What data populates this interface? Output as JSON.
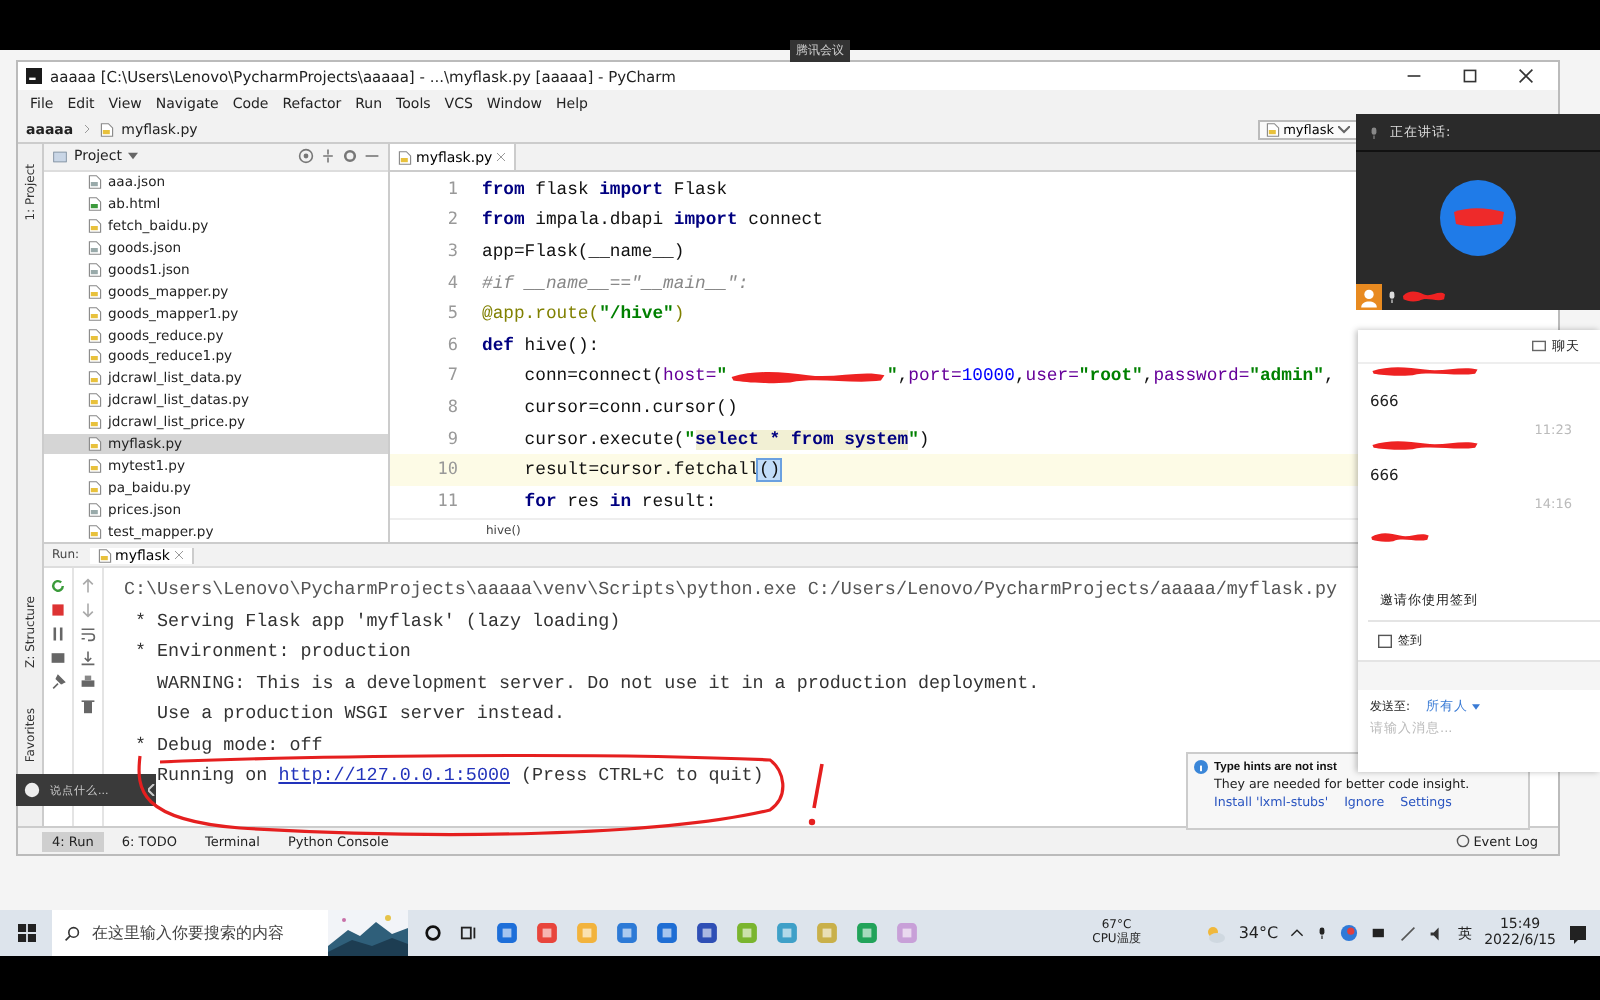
{
  "meeting_tag": "腾讯会议",
  "window": {
    "title": "aaaaa [C:\\Users\\Lenovo\\PycharmProjects\\aaaaa] - ...\\myflask.py [aaaaa] - PyCharm"
  },
  "menu": [
    "File",
    "Edit",
    "View",
    "Navigate",
    "Code",
    "Refactor",
    "Run",
    "Tools",
    "VCS",
    "Window",
    "Help"
  ],
  "breadcrumb": [
    "aaaaa",
    "myflask.py"
  ],
  "run_config": "myflask",
  "side_tabs": {
    "top": [
      "1: Project"
    ],
    "bottom": [
      "Z: Structure",
      "Favorites"
    ]
  },
  "project": {
    "title": "Project",
    "files": [
      {
        "name": "aaa.json",
        "kind": "json",
        "selected": false
      },
      {
        "name": "ab.html",
        "kind": "html",
        "selected": false
      },
      {
        "name": "fetch_baidu.py",
        "kind": "py",
        "selected": false
      },
      {
        "name": "goods.json",
        "kind": "json",
        "selected": false
      },
      {
        "name": "goods1.json",
        "kind": "json",
        "selected": false
      },
      {
        "name": "goods_mapper.py",
        "kind": "py",
        "selected": false
      },
      {
        "name": "goods_mapper1.py",
        "kind": "py",
        "selected": false
      },
      {
        "name": "goods_reduce.py",
        "kind": "py",
        "selected": false
      },
      {
        "name": "goods_reduce1.py",
        "kind": "py",
        "selected": false
      },
      {
        "name": "jdcrawl_list_data.py",
        "kind": "py",
        "selected": false
      },
      {
        "name": "jdcrawl_list_datas.py",
        "kind": "py",
        "selected": false
      },
      {
        "name": "jdcrawl_list_price.py",
        "kind": "py",
        "selected": false
      },
      {
        "name": "myflask.py",
        "kind": "py",
        "selected": true
      },
      {
        "name": "mytest1.py",
        "kind": "py",
        "selected": false
      },
      {
        "name": "pa_baidu.py",
        "kind": "py",
        "selected": false
      },
      {
        "name": "prices.json",
        "kind": "json",
        "selected": false
      },
      {
        "name": "test_mapper.py",
        "kind": "py",
        "selected": false
      }
    ]
  },
  "editor": {
    "tab": "myflask.py",
    "breadcrumb": "hive()",
    "lines": [
      {
        "number": "1",
        "current": false,
        "tokens": [
          {
            "kind": "keyword",
            "text": "from"
          },
          {
            "kind": "plain",
            "text": " flask "
          },
          {
            "kind": "keyword",
            "text": "import"
          },
          {
            "kind": "plain",
            "text": " Flask"
          }
        ]
      },
      {
        "number": "2",
        "current": false,
        "tokens": [
          {
            "kind": "keyword",
            "text": "from"
          },
          {
            "kind": "plain",
            "text": " impala.dbapi "
          },
          {
            "kind": "keyword",
            "text": "import"
          },
          {
            "kind": "plain",
            "text": " connect"
          }
        ]
      },
      {
        "number": "3",
        "current": false,
        "tokens": [
          {
            "kind": "plain",
            "text": "app=Flask(__name__)"
          }
        ]
      },
      {
        "number": "4",
        "current": false,
        "tokens": [
          {
            "kind": "comment",
            "text": "#if __name__==\"__main__\":"
          }
        ]
      },
      {
        "number": "5",
        "current": false,
        "tokens": [
          {
            "kind": "decorator",
            "text": "@app.route("
          },
          {
            "kind": "string",
            "text": "\"/hive\""
          },
          {
            "kind": "decorator",
            "text": ")"
          }
        ]
      },
      {
        "number": "6",
        "current": false,
        "tokens": [
          {
            "kind": "keyword",
            "text": "def"
          },
          {
            "kind": "plain",
            "text": " hive():"
          }
        ]
      },
      {
        "number": "7",
        "current": false,
        "tokens": [
          {
            "kind": "plain",
            "text": "    conn=connect("
          },
          {
            "kind": "param",
            "text": "host="
          },
          {
            "kind": "string",
            "text": "\""
          },
          {
            "kind": "redacted"
          },
          {
            "kind": "string",
            "text": "\""
          },
          {
            "kind": "plain",
            "text": ","
          },
          {
            "kind": "param",
            "text": "port="
          },
          {
            "kind": "number",
            "text": "10000"
          },
          {
            "kind": "plain",
            "text": ","
          },
          {
            "kind": "param",
            "text": "user="
          },
          {
            "kind": "string",
            "text": "\"root\""
          },
          {
            "kind": "plain",
            "text": ","
          },
          {
            "kind": "param",
            "text": "password="
          },
          {
            "kind": "string",
            "text": "\"admin\""
          },
          {
            "kind": "plain",
            "text": ","
          }
        ]
      },
      {
        "number": "8",
        "current": false,
        "tokens": [
          {
            "kind": "plain",
            "text": "    cursor=conn.cursor()"
          }
        ]
      },
      {
        "number": "9",
        "current": false,
        "tokens": [
          {
            "kind": "plain",
            "text": "    cursor.execute("
          },
          {
            "kind": "string",
            "text": "\""
          },
          {
            "kind": "sql",
            "text": "select * from system"
          },
          {
            "kind": "string",
            "text": "\""
          },
          {
            "kind": "plain",
            "text": ")"
          }
        ]
      },
      {
        "number": "10",
        "current": true,
        "tokens": [
          {
            "kind": "plain",
            "text": "    result=cursor.fetchall"
          },
          {
            "kind": "match",
            "text": "()"
          }
        ]
      },
      {
        "number": "11",
        "current": false,
        "tokens": [
          {
            "kind": "keyword",
            "text": "    for"
          },
          {
            "kind": "plain",
            "text": " res "
          },
          {
            "kind": "keyword",
            "text": "in"
          },
          {
            "kind": "plain",
            "text": " result:"
          }
        ]
      }
    ]
  },
  "run": {
    "label": "Run:",
    "tab": "myflask",
    "lines": [
      {
        "kind": "command",
        "segments": [
          {
            "kind": "text",
            "text": "C:\\Users\\Lenovo\\PycharmProjects\\aaaaa\\venv\\Scripts\\python.exe C:/Users/Lenovo/PycharmProjects/aaaaa/myflask.py"
          }
        ]
      },
      {
        "kind": "output",
        "segments": [
          {
            "kind": "text",
            "text": " * Serving Flask app 'myflask' (lazy loading)"
          }
        ]
      },
      {
        "kind": "output",
        "segments": [
          {
            "kind": "text",
            "text": " * Environment: production"
          }
        ]
      },
      {
        "kind": "output",
        "segments": [
          {
            "kind": "text",
            "text": "   WARNING: This is a development server. Do not use it in a production deployment."
          }
        ]
      },
      {
        "kind": "output",
        "segments": [
          {
            "kind": "text",
            "text": "   Use a production WSGI server instead."
          }
        ]
      },
      {
        "kind": "output",
        "segments": [
          {
            "kind": "text",
            "text": " * Debug mode: off"
          }
        ]
      },
      {
        "kind": "output",
        "segments": [
          {
            "kind": "text",
            "text": "   Running on "
          },
          {
            "kind": "link",
            "text": "http://127.0.0.1:5000"
          },
          {
            "kind": "text",
            "text": " (Press CTRL+C to quit)"
          }
        ]
      }
    ]
  },
  "tool_tabs": [
    {
      "label": "4: Run",
      "selected": true
    },
    {
      "label": "6: TODO",
      "selected": false
    },
    {
      "label": "Terminal",
      "selected": false
    },
    {
      "label": "Python Console",
      "selected": false
    }
  ],
  "event_log": "Event Log",
  "notification": {
    "title": "Type hints are not inst",
    "body": "They are needed for better code insight.",
    "links": [
      "Install 'lxml-stubs'",
      "Ignore",
      "Settings"
    ]
  },
  "video": {
    "speaking": "正在讲话:"
  },
  "chat": {
    "title": "聊天",
    "messages": [
      {
        "text": "666",
        "time": "11:23"
      },
      {
        "text": "666",
        "time": "14:16"
      }
    ],
    "invite": "邀请你使用签到",
    "checkin": "签到",
    "send_to": "发送至:",
    "recipient": "所有人",
    "placeholder": "请输入消息..."
  },
  "bubble": "说点什么...",
  "taskbar": {
    "search_placeholder": "在这里输入你要搜索的内容",
    "cpu_temp": "67°C",
    "cpu_label": "CPU温度",
    "weather": "34°C",
    "ime": "英",
    "time": "15:49",
    "date": "2022/6/15"
  }
}
